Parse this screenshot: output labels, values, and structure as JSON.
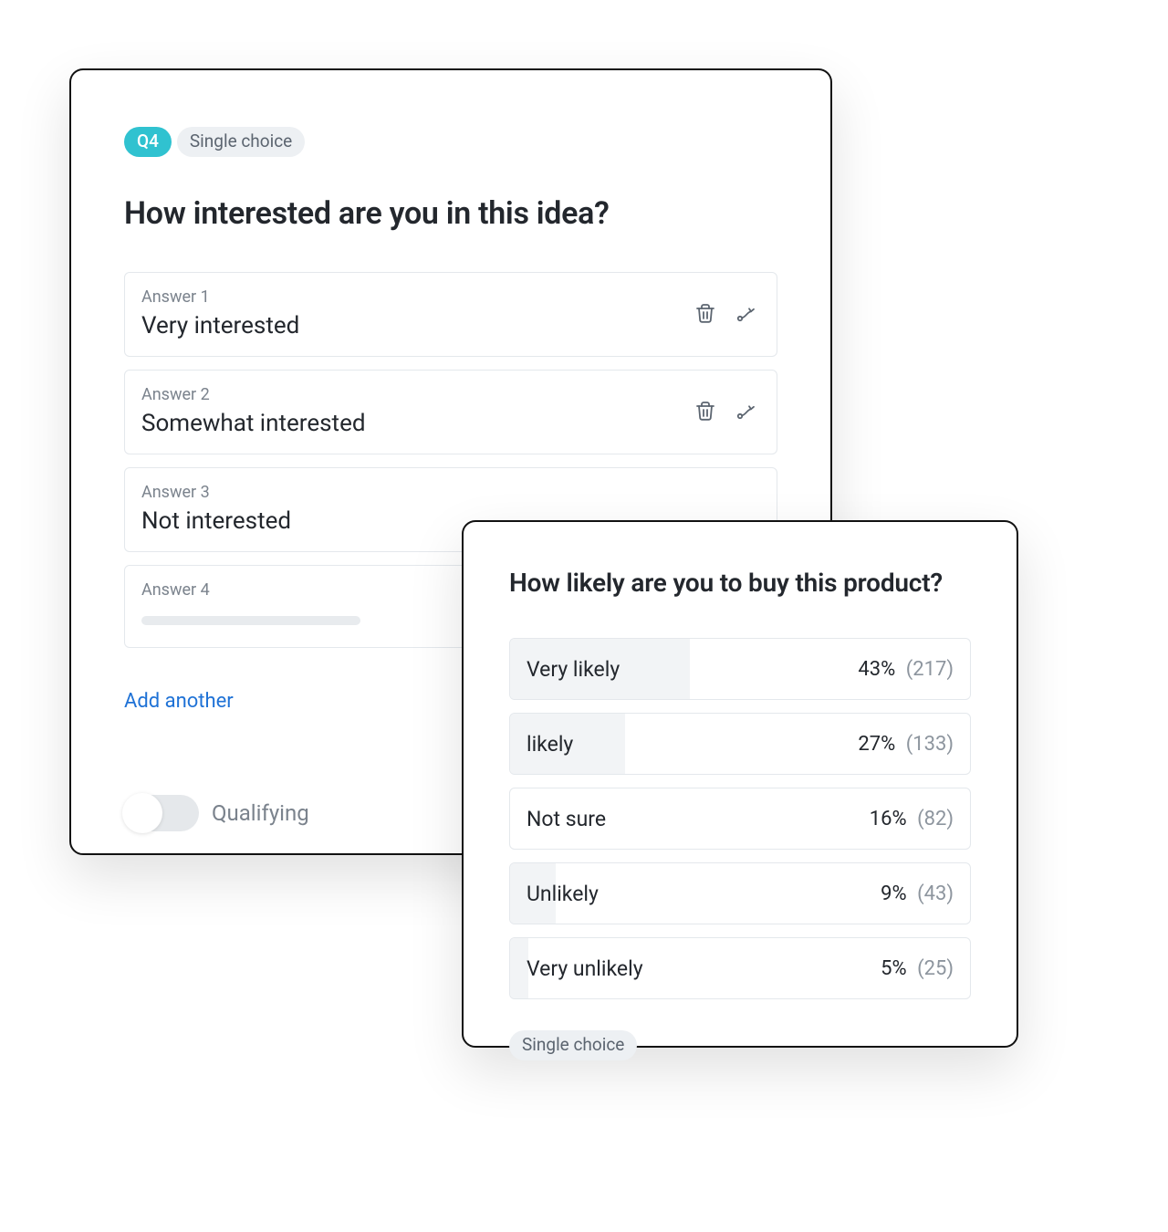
{
  "editor": {
    "question_number_label": "Q4",
    "question_type_label": "Single choice",
    "title": "How interested are you in this idea?",
    "answers": [
      {
        "label": "Answer 1",
        "text": "Very interested",
        "show_actions": true
      },
      {
        "label": "Answer 2",
        "text": "Somewhat interested",
        "show_actions": true
      },
      {
        "label": "Answer 3",
        "text": "Not interested",
        "show_actions": false
      },
      {
        "label": "Answer 4",
        "text": "",
        "show_actions": false
      }
    ],
    "add_another_label": "Add another",
    "qualifying_label": "Qualifying"
  },
  "results": {
    "title": "How likely are you to buy this product?",
    "rows": [
      {
        "label": "Very likely",
        "percent": 43,
        "count": 217,
        "fill_pct": 39
      },
      {
        "label": "likely",
        "percent": 27,
        "count": 133,
        "fill_pct": 25
      },
      {
        "label": "Not sure",
        "percent": 16,
        "count": 82,
        "fill_pct": 0
      },
      {
        "label": "Unlikely",
        "percent": 9,
        "count": 43,
        "fill_pct": 10
      },
      {
        "label": "Very unlikely",
        "percent": 5,
        "count": 25,
        "fill_pct": 4
      }
    ],
    "type_label": "Single choice"
  },
  "chart_data": {
    "type": "bar",
    "orientation": "horizontal",
    "title": "How likely are you to buy this product?",
    "categories": [
      "Very likely",
      "likely",
      "Not sure",
      "Unlikely",
      "Very unlikely"
    ],
    "series": [
      {
        "name": "percent",
        "values": [
          43,
          27,
          16,
          9,
          5
        ]
      },
      {
        "name": "count",
        "values": [
          217,
          133,
          82,
          43,
          25
        ]
      }
    ],
    "xlabel": "",
    "ylabel": "",
    "xlim": [
      0,
      100
    ]
  }
}
